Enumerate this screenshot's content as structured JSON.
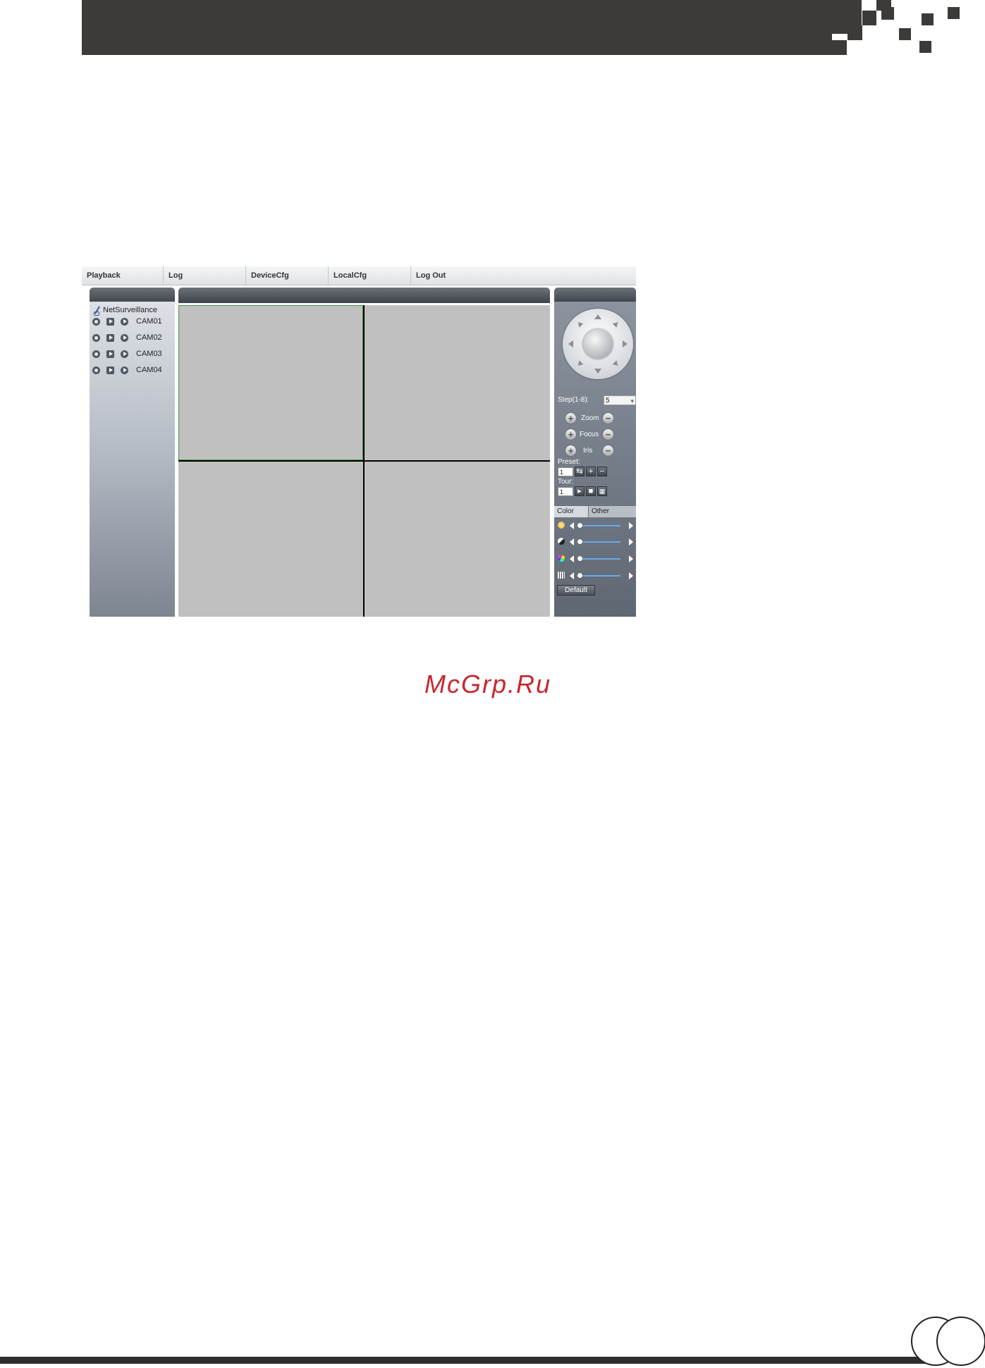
{
  "menu": {
    "items": [
      "Playback",
      "Log",
      "DeviceCfg",
      "LocalCfg",
      "Log Out"
    ]
  },
  "tree": {
    "root_label": "NetSurveillance",
    "cameras": [
      "CAM01",
      "CAM02",
      "CAM03",
      "CAM04"
    ]
  },
  "ptz": {
    "step_label": "Step(1-8):",
    "step_value": "5",
    "zoom_label": "Zoom",
    "focus_label": "Focus",
    "iris_label": "Iris",
    "preset_label": "Preset:",
    "preset_value": "1",
    "tour_label": "Tour:",
    "tour_value": "1"
  },
  "color_panel": {
    "tabs": [
      "Color",
      "Other"
    ],
    "default_label": "Default",
    "sliders": [
      "brightness-icon",
      "contrast-icon",
      "saturation-icon",
      "hue-icon"
    ]
  },
  "watermark": "McGrp.Ru",
  "colors": {
    "header_band": "#3c3b39",
    "watermark": "#c9262c",
    "video_cell": "#c0c0c0",
    "selected_cell_border": "#3a9a3a"
  }
}
